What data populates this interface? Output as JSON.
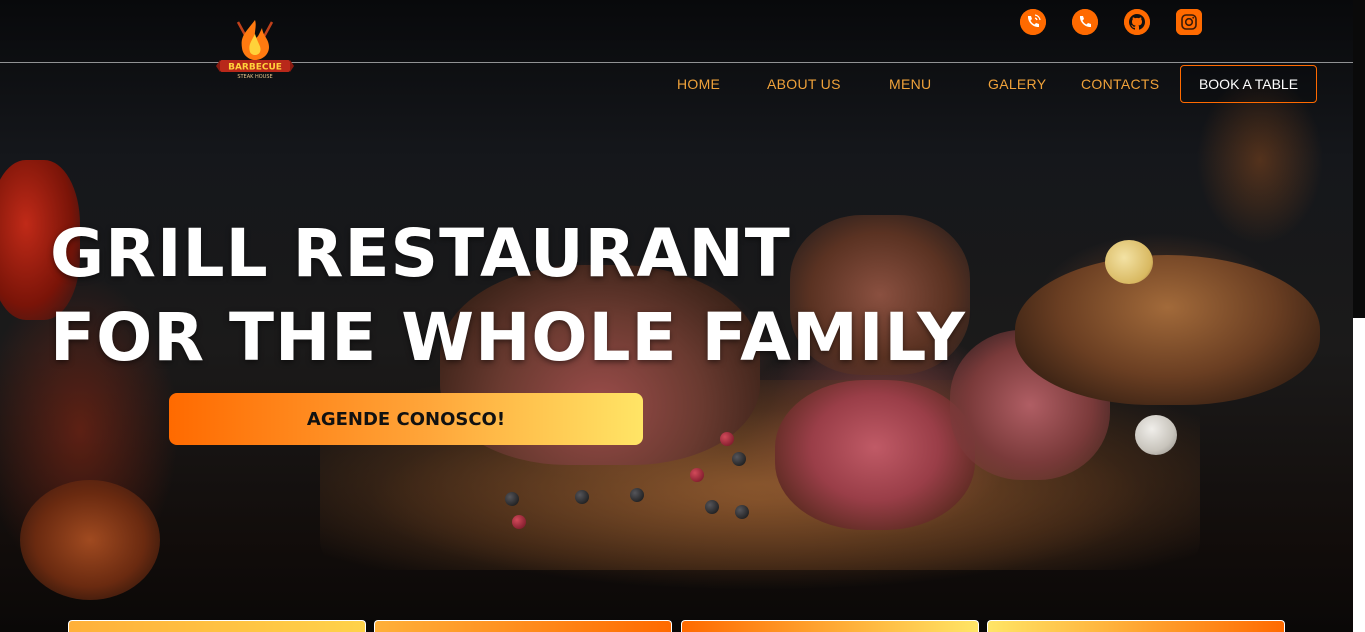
{
  "logo": {
    "text": "BARBECUE",
    "subtext": "STEAK HOUSE"
  },
  "socials": [
    {
      "name": "phone-call-icon"
    },
    {
      "name": "phone-icon"
    },
    {
      "name": "github-icon"
    },
    {
      "name": "instagram-icon"
    }
  ],
  "nav": {
    "items": [
      "HOME",
      "ABOUT US",
      "MENU",
      "GALERY",
      "CONTACTS"
    ],
    "book_label": "BOOK A TABLE"
  },
  "hero": {
    "line1": "GRILL RESTAURANT",
    "line2": "FOR THE WHOLE FAMILY",
    "cta_label": "AGENDE CONOSCO!"
  },
  "colors": {
    "accent": "#ff6a00",
    "nav_text": "#f0a23a",
    "cta_end": "#ffe566"
  }
}
